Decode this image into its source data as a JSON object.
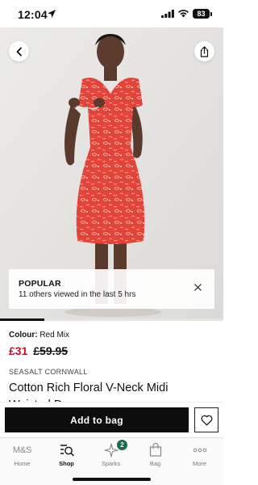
{
  "status_bar": {
    "time": "12:04",
    "battery": "83"
  },
  "popular": {
    "title": "POPULAR",
    "subtitle": "11 others viewed in the last 5 hrs"
  },
  "gallery": {
    "progress": 0.2
  },
  "product": {
    "colour_label": "Colour:",
    "colour_value": "Red Mix",
    "price_now": "£31",
    "price_was": "£59.95",
    "brand": "SEASALT CORNWALL",
    "name": "Cotton Rich Floral V-Neck Midi Waisted Dress"
  },
  "actions": {
    "add_to_bag": "Add to bag"
  },
  "tabs": [
    {
      "label": "Home",
      "icon": "ms-logo"
    },
    {
      "label": "Shop",
      "icon": "search-list-icon",
      "active": true
    },
    {
      "label": "Sparks",
      "icon": "sparks-icon",
      "badge": "2"
    },
    {
      "label": "Bag",
      "icon": "bag-icon"
    },
    {
      "label": "More",
      "icon": "more-icon"
    }
  ],
  "home_logo": "M&S",
  "colors": {
    "accent": "#c0122c",
    "dress": "#e0443a",
    "badge": "#1a6a4f"
  }
}
